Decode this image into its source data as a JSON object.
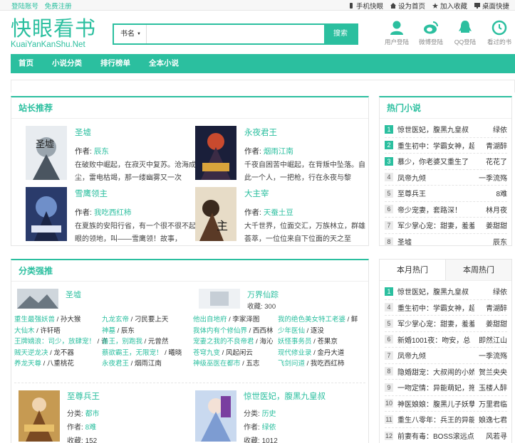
{
  "topbar": {
    "login": "登陆账号",
    "register": "免费注册",
    "links": [
      {
        "label": "手机快眼",
        "icon": "mobile-icon"
      },
      {
        "label": "设为首页",
        "icon": "home-icon"
      },
      {
        "label": "加入收藏",
        "icon": "star-icon"
      },
      {
        "label": "桌面快捷",
        "icon": "desktop-icon"
      }
    ]
  },
  "logo": {
    "title": "快眼看书",
    "subtitle": "KuaiYanKanShu.Net"
  },
  "search": {
    "category": "书名",
    "placeholder": "",
    "button": "搜索"
  },
  "header_icons": [
    {
      "label": "用户登陆",
      "icon": "user-icon"
    },
    {
      "label": "微博登陆",
      "icon": "weibo-icon"
    },
    {
      "label": "QQ登陆",
      "icon": "qq-icon"
    },
    {
      "label": "看过的书",
      "icon": "history-icon"
    }
  ],
  "nav": [
    "首页",
    "小说分类",
    "排行榜单",
    "全本小说"
  ],
  "recommend": {
    "title": "站长推荐",
    "books": [
      {
        "title": "圣墟",
        "author_label": "作者:",
        "author": "辰东",
        "desc": "在破败中崛起，在寂灭中复苏。沧海成尘，雷电枯竭，那一缕幽雾又一次"
      },
      {
        "title": "永夜君王",
        "author_label": "作者:",
        "author": "烟雨江南",
        "desc": "千夜自困苦中崛起，在背叛中坠落。自此一个人，一把枪，行在永夜与黎"
      },
      {
        "title": "雪鹰领主",
        "author_label": "作者:",
        "author": "我吃西红柿",
        "desc": "在夏族的安阳行省，有一个很不很不起眼的领地，叫——雪鹰领！故事，"
      },
      {
        "title": "大主宰",
        "author_label": "作者:",
        "author": "天蚕土豆",
        "desc": "大千世界，位面交汇，万族林立，群雄荟萃，一位位来自下位面的天之至"
      }
    ]
  },
  "hot": {
    "title": "热门小说",
    "items": [
      {
        "num": "1",
        "name": "惊世医妃，腹黑九皇叔",
        "author": "绿依"
      },
      {
        "num": "2",
        "name": "重生初中：学霸女神，超",
        "author": "青湖醉"
      },
      {
        "num": "3",
        "name": "慕少，你老婆又重生了",
        "author": "花花了"
      },
      {
        "num": "4",
        "name": "凤帝九倾",
        "author": "一季流殇"
      },
      {
        "num": "5",
        "name": "至尊兵王",
        "author": "8难"
      },
      {
        "num": "6",
        "name": "帝少宠妻，套路深！",
        "author": "林月夜"
      },
      {
        "num": "7",
        "name": "军少掌心宠：甜妻，羞羞",
        "author": "姜甜甜"
      },
      {
        "num": "8",
        "name": "圣墟",
        "author": "辰东"
      }
    ]
  },
  "category": {
    "title": "分类强推",
    "cols": [
      {
        "title": "圣墟",
        "links": [
          [
            {
              "t": "重生最强妖兽",
              "g": true
            },
            {
              "t": " / 孙大猴",
              "g": false
            }
          ],
          [
            {
              "t": "大仙木",
              "g": true
            },
            {
              "t": " / 许轩晤",
              "g": false
            }
          ],
          [
            {
              "t": "王牌嫡浪：司少，放肆宠！",
              "g": true
            },
            {
              "t": " / 许",
              "g": false
            }
          ],
          [
            {
              "t": "贼天逆龙决",
              "g": true
            },
            {
              "t": " / 龙不器",
              "g": false
            }
          ],
          [
            {
              "t": "养龙天尊",
              "g": true
            },
            {
              "t": " / 八重桃花",
              "g": false
            }
          ]
        ],
        "links2": [
          [
            {
              "t": "九龙玄帝",
              "g": true
            },
            {
              "t": " / 刁民要上天",
              "g": false
            }
          ],
          [
            {
              "t": "神墓",
              "g": true
            },
            {
              "t": " / 辰东",
              "g": false
            }
          ],
          [
            {
              "t": "善王，别跑我",
              "g": true
            },
            {
              "t": " / 元曾然",
              "g": false
            }
          ],
          [
            {
              "t": "蔡欲霸王，无限宠！",
              "g": true
            },
            {
              "t": " / 曦晓",
              "g": false
            }
          ],
          [
            {
              "t": "永夜君王",
              "g": true
            },
            {
              "t": " / 烟雨江南",
              "g": false
            }
          ]
        ]
      },
      {
        "title": "万界仙踪",
        "meta": "收藏: 300",
        "links": [
          [
            {
              "t": "他出自地府",
              "g": true
            },
            {
              "t": " / 李家泽图",
              "g": false
            }
          ],
          [
            {
              "t": "我体内有个修仙界",
              "g": true
            },
            {
              "t": " / 西西林",
              "g": false
            }
          ],
          [
            {
              "t": "宠妻之我的不良帝君",
              "g": true
            },
            {
              "t": " / 海沁",
              "g": false
            }
          ],
          [
            {
              "t": "苍穹九变",
              "g": true
            },
            {
              "t": " / 风起闲云",
              "g": false
            }
          ],
          [
            {
              "t": "神级巫医在都市",
              "g": true
            },
            {
              "t": " / 五志",
              "g": false
            }
          ]
        ],
        "links2": [
          [
            {
              "t": "我的绝色美女特工老婆",
              "g": true
            },
            {
              "t": " / 鲜",
              "g": false
            }
          ],
          [
            {
              "t": "少年医仙",
              "g": true
            },
            {
              "t": " / 逐没",
              "g": false
            }
          ],
          [
            {
              "t": "妖怪事务员",
              "g": true
            },
            {
              "t": " / 苍果京",
              "g": false
            }
          ],
          [
            {
              "t": "现代修业录",
              "g": true
            },
            {
              "t": " / 金丹大道",
              "g": false
            }
          ],
          [
            {
              "t": "飞剑问道",
              "g": true
            },
            {
              "t": " / 我吃西红柿",
              "g": false
            }
          ]
        ]
      }
    ],
    "books": [
      {
        "title": "至尊兵王",
        "cat_label": "分类:",
        "cat": "都市",
        "author_label": "作者:",
        "author": "8难",
        "fav_label": "收藏:",
        "fav": "152"
      },
      {
        "title": "惊世医妃，腹黑九皇叔",
        "cat_label": "分类:",
        "cat": "历史",
        "author_label": "作者:",
        "author": "绿依",
        "fav_label": "收藏:",
        "fav": "1012"
      }
    ]
  },
  "rank": {
    "tabs": [
      "本月热门",
      "本周热门"
    ],
    "items": [
      {
        "num": "1",
        "name": "惊世医妃，腹黑九皇叔",
        "author": "绿依"
      },
      {
        "num": "4",
        "name": "重生初中：学霸女神，超给",
        "author": "青湖醉"
      },
      {
        "num": "5",
        "name": "军少掌心宠：甜妻，羞羞",
        "author": "姜甜甜"
      },
      {
        "num": "6",
        "name": "新婚1001夜：吻安，总",
        "author": "即然江山"
      },
      {
        "num": "7",
        "name": "凤帝九倾",
        "author": "一季流殇"
      },
      {
        "num": "8",
        "name": "隐婚甜宠：大叔闹的小娇",
        "author": "贺兰央央"
      },
      {
        "num": "9",
        "name": "一吻定情：异能萌妃，拖",
        "author": "玉楼人醉"
      },
      {
        "num": "10",
        "name": "神医娘娘：腹黑儿子妖孽",
        "author": "万里君临"
      },
      {
        "num": "11",
        "name": "重生八零年：兵王的异能",
        "author": "娘逸七君"
      },
      {
        "num": "12",
        "name": "前妻有毒：BOSS滚远点",
        "author": "风若寻"
      }
    ]
  }
}
